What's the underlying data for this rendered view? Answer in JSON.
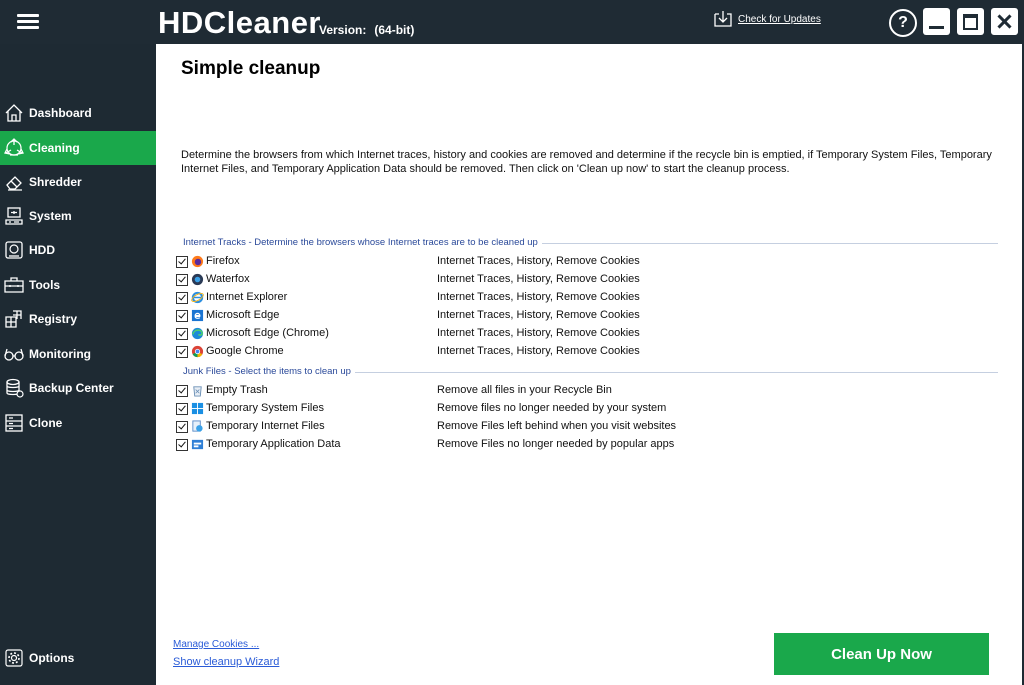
{
  "app": {
    "name": "HDCleaner",
    "version_label": "Version:",
    "version_value": "(64-bit)"
  },
  "header": {
    "update_link": "Check for Updates",
    "help": "?"
  },
  "sidebar": {
    "items": [
      {
        "label": "Dashboard",
        "icon": "house-icon"
      },
      {
        "label": "Cleaning",
        "icon": "recycle-icon",
        "active": true
      },
      {
        "label": "Shredder",
        "icon": "eraser-icon"
      },
      {
        "label": "System",
        "icon": "system-icon"
      },
      {
        "label": "HDD",
        "icon": "hdd-icon"
      },
      {
        "label": "Tools",
        "icon": "toolbox-icon"
      },
      {
        "label": "Registry",
        "icon": "registry-icon"
      },
      {
        "label": "Monitoring",
        "icon": "glasses-icon"
      },
      {
        "label": "Backup Center",
        "icon": "database-icon"
      },
      {
        "label": "Clone",
        "icon": "clone-icon"
      }
    ],
    "options_label": "Options"
  },
  "main": {
    "title": "Simple cleanup",
    "description": "Determine the browsers from which Internet traces, history and cookies are removed and determine if the recycle bin is emptied, if Temporary System Files, Temporary Internet Files, and Temporary Application Data should be removed. Then click on 'Clean up now' to start the cleanup process.",
    "internet_section": {
      "title": "Internet Tracks - Determine the browsers whose Internet traces are to be cleaned up",
      "rows": [
        {
          "label": "Firefox",
          "desc": "Internet Traces, History, Remove Cookies",
          "checked": true,
          "icon": "firefox-icon"
        },
        {
          "label": "Waterfox",
          "desc": "Internet Traces, History, Remove Cookies",
          "checked": true,
          "icon": "waterfox-icon"
        },
        {
          "label": "Internet Explorer",
          "desc": "Internet Traces, History, Remove Cookies",
          "checked": true,
          "icon": "internet-explorer-icon"
        },
        {
          "label": "Microsoft Edge",
          "desc": "Internet Traces, History, Remove Cookies",
          "checked": true,
          "icon": "edge-icon"
        },
        {
          "label": "Microsoft Edge (Chrome)",
          "desc": "Internet Traces, History, Remove Cookies",
          "checked": true,
          "icon": "edge-chromium-icon"
        },
        {
          "label": "Google Chrome",
          "desc": "Internet Traces, History, Remove Cookies",
          "checked": true,
          "icon": "chrome-icon"
        }
      ]
    },
    "junk_section": {
      "title": "Junk Files - Select the items to clean up",
      "rows": [
        {
          "label": "Empty Trash",
          "desc": "Remove all files in your Recycle Bin",
          "checked": true,
          "icon": "trash-icon"
        },
        {
          "label": "Temporary System Files",
          "desc": "Remove files no longer needed by your system",
          "checked": true,
          "icon": "windows-icon"
        },
        {
          "label": "Temporary Internet Files",
          "desc": "Remove Files left behind when you visit websites",
          "checked": true,
          "icon": "internet-files-icon"
        },
        {
          "label": "Temporary Application Data",
          "desc": "Remove Files no longer needed by popular apps",
          "checked": true,
          "icon": "app-data-icon"
        }
      ]
    },
    "manage_cookies": "Manage Cookies ...",
    "show_wizard": "Show cleanup Wizard",
    "clean_button": "Clean Up Now"
  },
  "colors": {
    "accent": "#1aa84b",
    "sidebar_bg": "#1e2a33",
    "section_title": "#2b4a9a",
    "link": "#2a5bd7"
  }
}
